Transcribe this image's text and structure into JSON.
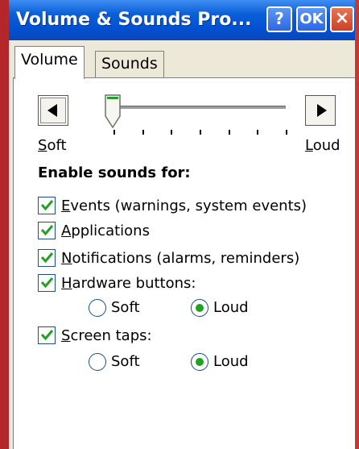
{
  "window": {
    "title": "Volume & Sounds Pro...",
    "help_label": "?",
    "ok_label": "OK",
    "close_label": "×"
  },
  "tabs": [
    {
      "label": "Volume",
      "active": true
    },
    {
      "label": "Sounds",
      "active": false
    }
  ],
  "volume": {
    "soft_first": "S",
    "soft_rest": "oft",
    "loud_first": "L",
    "loud_rest": "oud",
    "level": 0,
    "tick_count": 7
  },
  "enable_heading": "Enable sounds for:",
  "options": [
    {
      "mnemonic": "E",
      "rest": "vents (warnings, system events)",
      "checked": true
    },
    {
      "mnemonic": "A",
      "rest": "pplications",
      "checked": true
    },
    {
      "mnemonic": "N",
      "rest": "otifications (alarms, reminders)",
      "checked": true
    },
    {
      "mnemonic": "H",
      "rest": "ardware buttons:",
      "checked": true
    },
    {
      "mnemonic": "S",
      "rest": "creen taps:",
      "checked": true
    }
  ],
  "hardware_radios": [
    {
      "label": "Soft",
      "selected": false
    },
    {
      "label": "Loud",
      "selected": true
    }
  ],
  "screen_radios": [
    {
      "label": "Soft",
      "selected": false
    },
    {
      "label": "Loud",
      "selected": true
    }
  ],
  "colors": {
    "titlebar": "#0451d3",
    "check_green": "#21a121",
    "frame_red": "#b3262a"
  }
}
